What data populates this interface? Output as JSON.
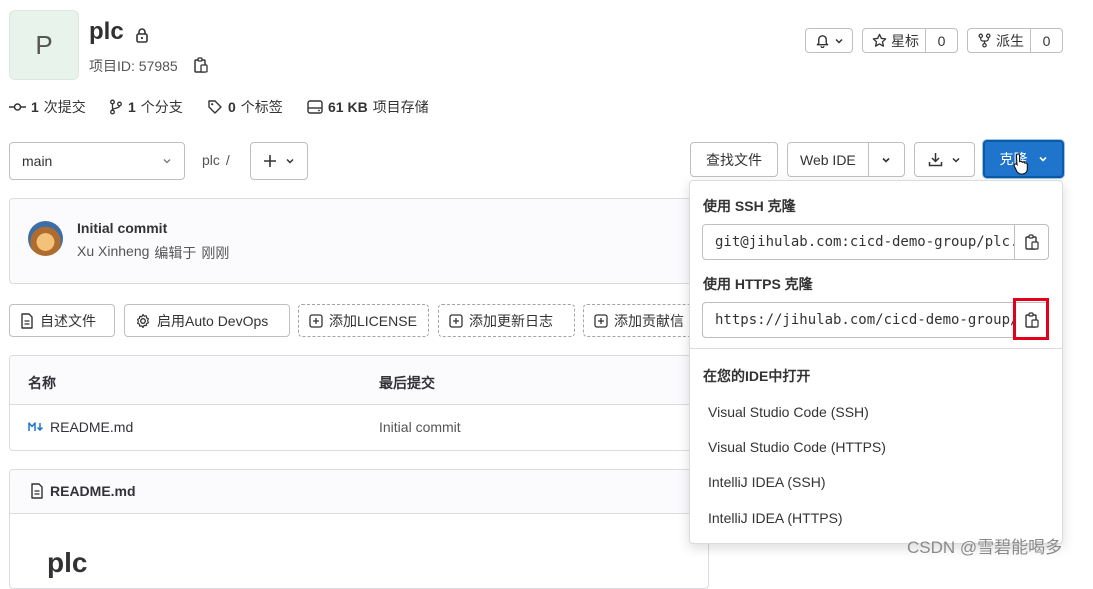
{
  "project": {
    "avatar_letter": "P",
    "name": "plc",
    "id_text": "项目ID: 57985"
  },
  "header_actions": {
    "star_label": "星标",
    "star_count": "0",
    "fork_label": "派生",
    "fork_count": "0"
  },
  "stats": [
    {
      "value": "1",
      "label": "次提交"
    },
    {
      "value": "1",
      "label": "个分支"
    },
    {
      "value": "0",
      "label": "个标签"
    },
    {
      "value": "61 KB",
      "label": "项目存储"
    }
  ],
  "toolbar": {
    "branch": "main",
    "path_root": "plc",
    "path_sep": "/",
    "find_file": "查找文件",
    "web_ide": "Web IDE",
    "clone": "克隆"
  },
  "commit": {
    "message": "Initial commit",
    "author": "Xu Xinheng",
    "action": "编辑于",
    "time": "刚刚"
  },
  "quick_buttons": {
    "readme": "自述文件",
    "autodevops": "启用Auto DevOps",
    "license": "添加LICENSE",
    "changelog": "添加更新日志",
    "contributing": "添加贡献信"
  },
  "file_table": {
    "col_name": "名称",
    "col_last_commit": "最后提交",
    "rows": [
      {
        "name": "README.md",
        "commit": "Initial commit"
      }
    ]
  },
  "readme_panel": {
    "title": "README.md",
    "content_heading": "plc"
  },
  "clone_dropdown": {
    "ssh_label": "使用 SSH 克隆",
    "ssh_url": "git@jihulab.com:cicd-demo-group/plc.git",
    "https_label": "使用 HTTPS 克隆",
    "https_url": "https://jihulab.com/cicd-demo-group/plc.git",
    "ide_header": "在您的IDE中打开",
    "ide_options": [
      "Visual Studio Code (SSH)",
      "Visual Studio Code (HTTPS)",
      "IntelliJ IDEA (SSH)",
      "IntelliJ IDEA (HTTPS)"
    ]
  },
  "watermark": "CSDN @雪碧能喝多",
  "colors": {
    "primary": "#1f75cb",
    "highlight_box": "#e3001b",
    "border": "#bfbfc3"
  }
}
